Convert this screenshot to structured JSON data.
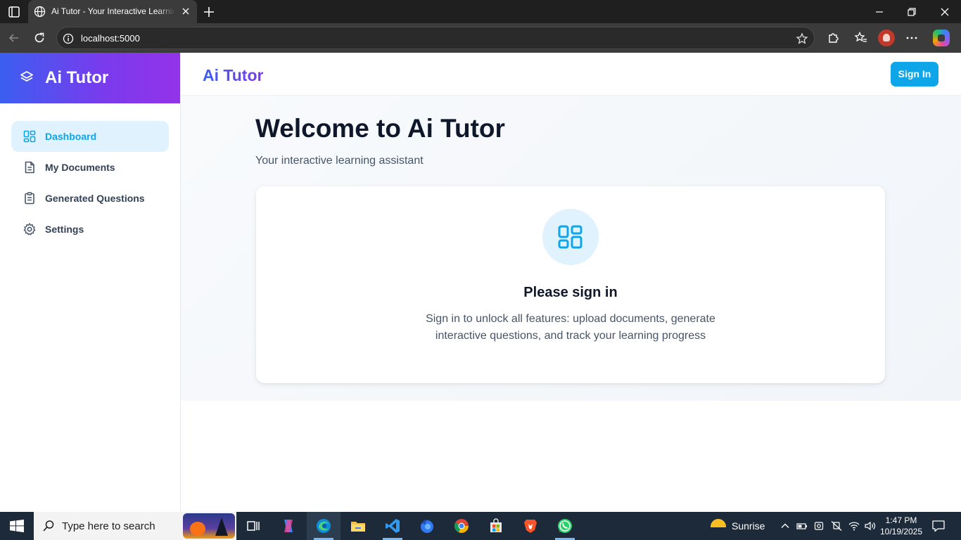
{
  "browser": {
    "tab_title": "Ai Tutor - Your Interactive Learning Assistant",
    "url": "localhost:5000"
  },
  "app": {
    "brand_name": "Ai Tutor",
    "header_title": "Ai Tutor",
    "signin_label": "Sign In",
    "nav": [
      {
        "label": "Dashboard",
        "icon": "dashboard-icon",
        "active": true
      },
      {
        "label": "My Documents",
        "icon": "document-icon",
        "active": false
      },
      {
        "label": "Generated Questions",
        "icon": "clipboard-icon",
        "active": false
      },
      {
        "label": "Settings",
        "icon": "gear-icon",
        "active": false
      }
    ],
    "main": {
      "welcome": "Welcome to Ai Tutor",
      "subtitle": "Your interactive learning assistant",
      "card_title": "Please sign in",
      "card_desc": "Sign in to unlock all features: upload documents, generate interactive questions, and track your learning progress"
    },
    "colors": {
      "accent": "#0ea5e9",
      "brand_gradient_start": "#3b5ef0",
      "brand_gradient_end": "#9333ea"
    }
  },
  "taskbar": {
    "search_placeholder": "Type here to search",
    "weather_label": "Sunrise",
    "time": "1:47 PM",
    "date": "10/19/2025"
  }
}
